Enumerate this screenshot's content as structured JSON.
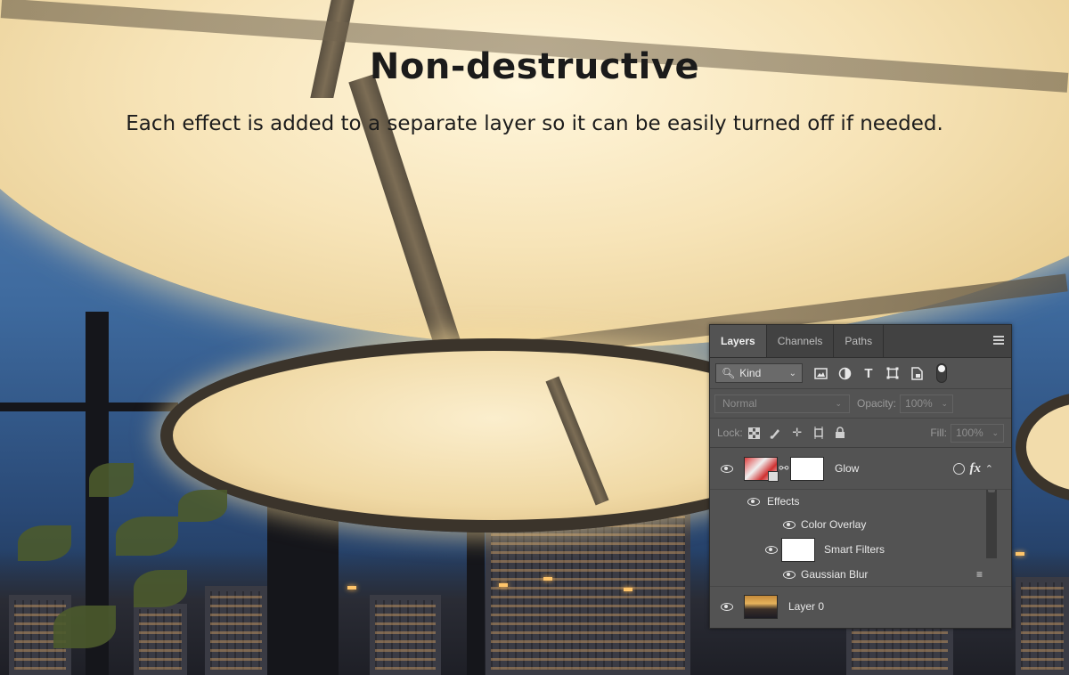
{
  "heading": {
    "title": "Non-destructive",
    "subtitle": "Each effect is added to a separate layer so it can be easily turned off if needed."
  },
  "layers_panel": {
    "tabs": [
      {
        "label": "Layers",
        "active": true
      },
      {
        "label": "Channels",
        "active": false
      },
      {
        "label": "Paths",
        "active": false
      }
    ],
    "filter": {
      "kind_label": "Kind",
      "icons": [
        "image-filter-icon",
        "adjustment-filter-icon",
        "type-filter-icon",
        "shape-filter-icon",
        "smart-object-filter-icon"
      ]
    },
    "blend_mode": "Normal",
    "opacity_label": "Opacity:",
    "opacity_value": "100%",
    "lock_label": "Lock:",
    "fill_label": "Fill:",
    "fill_value": "100%",
    "layers": {
      "glow": {
        "name": "Glow"
      },
      "effects": {
        "name": "Effects"
      },
      "color_overlay": {
        "name": "Color Overlay"
      },
      "smart_filters": {
        "name": "Smart Filters"
      },
      "gaussian_blur": {
        "name": "Gaussian Blur"
      },
      "layer0": {
        "name": "Layer 0"
      }
    }
  },
  "colors": {
    "panel_bg": "#535353",
    "tab_bar_bg": "#424242",
    "text_light": "#e8e8e8",
    "ceiling_glow": "#f7e4b8",
    "sky": "#3e6a9e"
  }
}
